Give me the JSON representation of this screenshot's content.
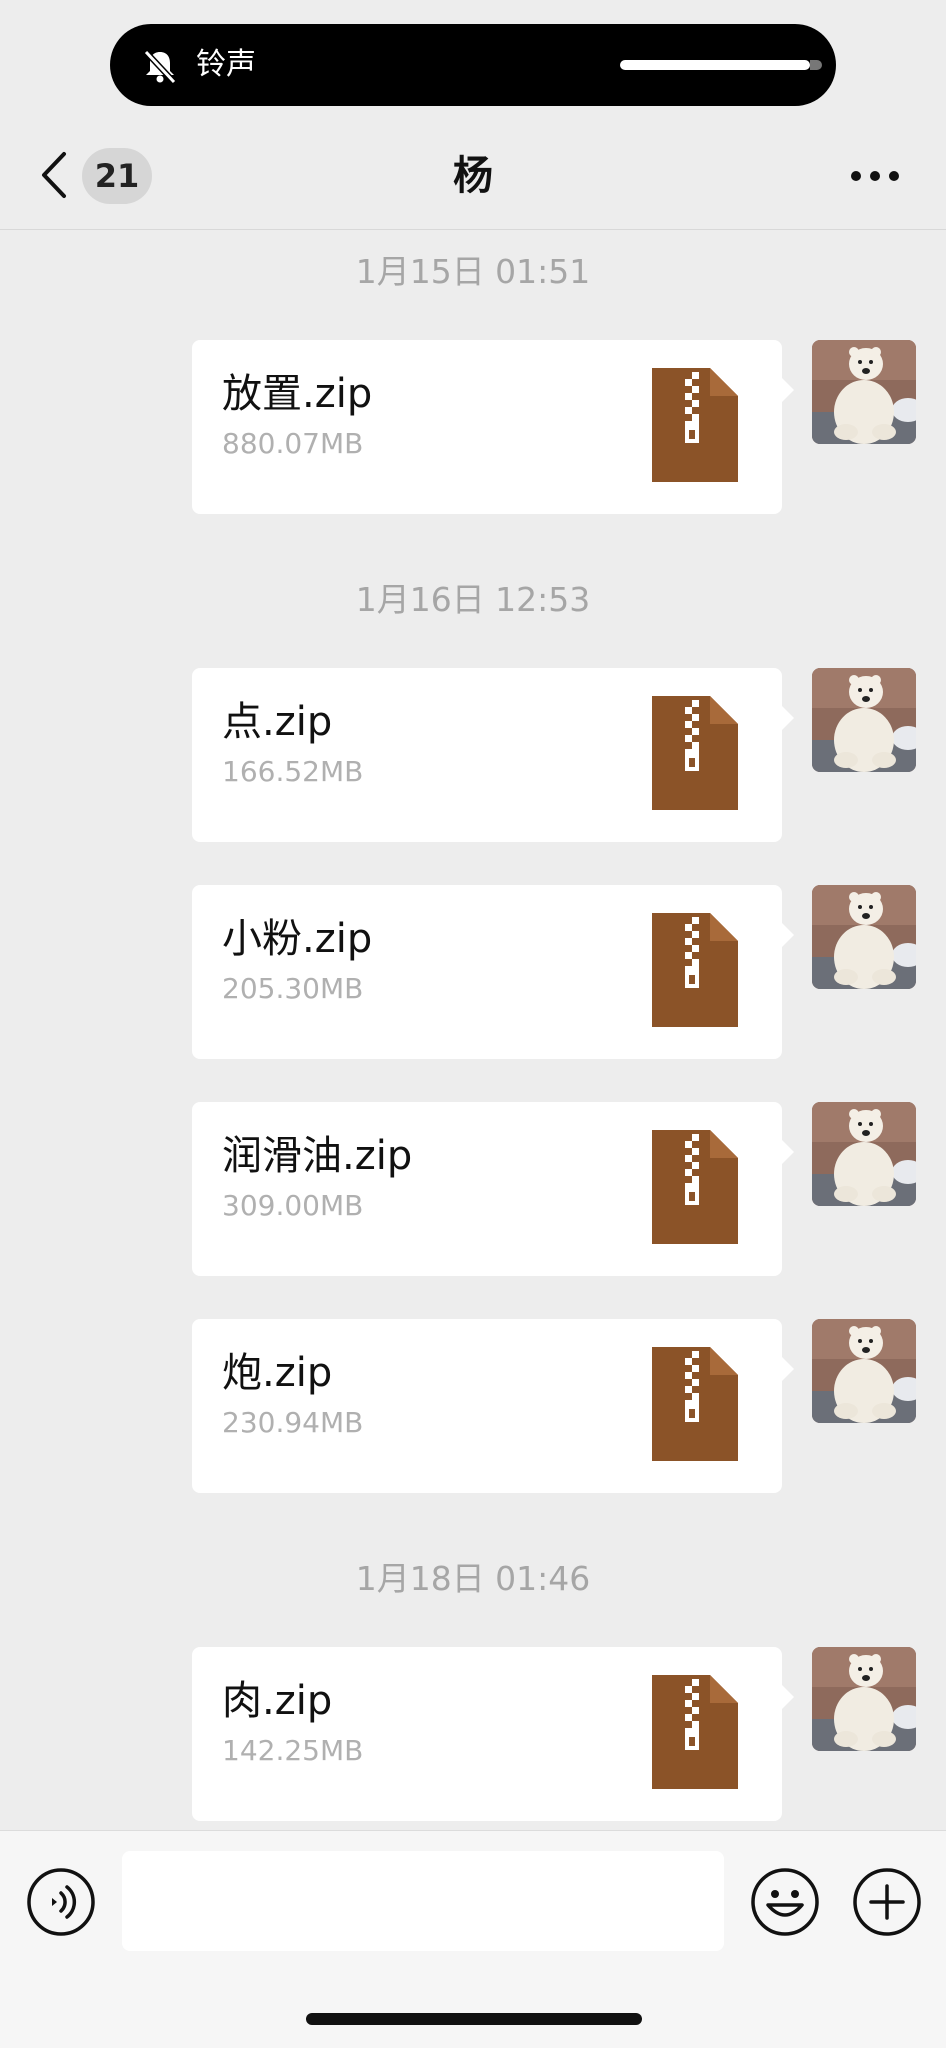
{
  "status": {
    "ringer_label": "铃声"
  },
  "header": {
    "unread_count": "21",
    "title": "杨"
  },
  "messages": [
    {
      "timestamp": "1月15日 01:51",
      "file_name": "放置.zip",
      "file_size": "880.07MB"
    },
    {
      "timestamp": "1月16日 12:53",
      "file_name": "点.zip",
      "file_size": "166.52MB"
    },
    {
      "timestamp": "",
      "file_name": "小粉.zip",
      "file_size": "205.30MB"
    },
    {
      "timestamp": "",
      "file_name": "润滑油.zip",
      "file_size": "309.00MB"
    },
    {
      "timestamp": "",
      "file_name": "炮.zip",
      "file_size": "230.94MB"
    },
    {
      "timestamp": "1月18日 01:46",
      "file_name": "肉.zip",
      "file_size": "142.25MB"
    }
  ],
  "colors": {
    "zip_icon": "#8b5328",
    "background": "#ededed",
    "bubble": "#ffffff"
  },
  "icons": {
    "status": "bell-slash-icon",
    "back": "chevron-left-icon",
    "more": "more-icon",
    "file": "zip-file-icon",
    "voice": "voice-icon",
    "emoji": "emoji-icon",
    "plus": "plus-icon"
  }
}
